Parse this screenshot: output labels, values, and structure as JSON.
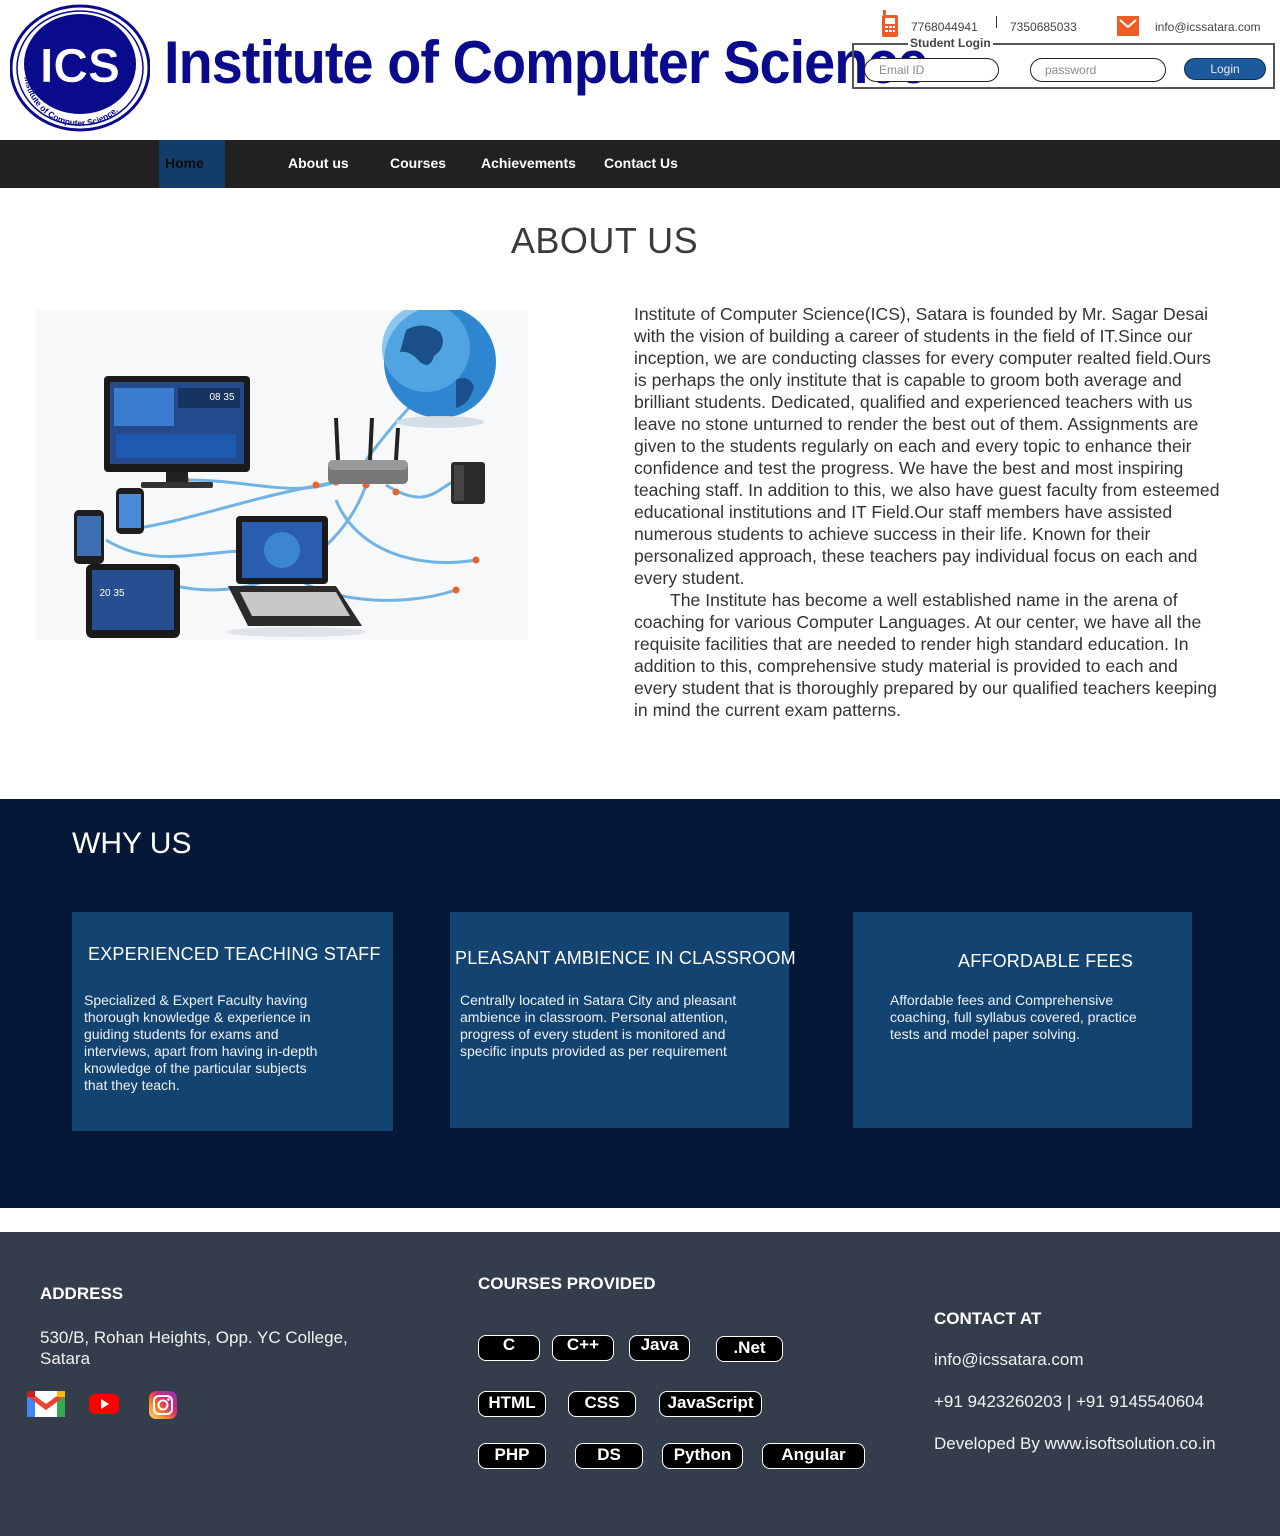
{
  "header": {
    "logo_text": "ICS",
    "logo_ring_text": "Institute of Computer Science.",
    "title": "Institute of Computer Science",
    "phone1": "7768044941",
    "phone2": "7350685033",
    "email": "info@icssatara.com",
    "login": {
      "legend": "Student Login",
      "email_placeholder": "Email ID",
      "password_placeholder": "password",
      "button": "Login"
    }
  },
  "nav": {
    "items": [
      {
        "label": "Home",
        "active": true
      },
      {
        "label": "About us"
      },
      {
        "label": "Courses"
      },
      {
        "label": "Achievements"
      },
      {
        "label": "Contact Us"
      }
    ]
  },
  "about": {
    "title": "ABOUT US",
    "paragraph1": "Institute of Computer Science(ICS), Satara is founded by Mr. Sagar Desai with the vision of building a career of students in the field of IT.Since our inception, we are conducting classes for every computer realted field.Ours is perhaps the only institute that is capable to groom both average and brilliant students. Dedicated, qualified and experienced teachers with us leave no stone unturned to render the best out of them. Assignments are given to the students regularly on each and every topic to enhance their confidence and test the progress. We have the best and most inspiring teaching staff. In addition to this, we also have guest faculty from esteemed educational institutions and IT Field.Our staff members have assisted numerous students to achieve success in their life. Known for their personalized approach, these teachers pay individual focus on each and every student.",
    "paragraph2": "The Institute has become a well established name in the arena of coaching for various Computer Languages. At our center, we have all the requisite facilities that are needed to render high standard education. In addition to this, comprehensive study material is provided to each and every student that is thoroughly prepared by our qualified teachers keeping in mind the current exam patterns.",
    "image_screen1": "08 35",
    "image_screen2": "20 35"
  },
  "why": {
    "title": "WHY US",
    "cards": [
      {
        "title": "EXPERIENCED TEACHING STAFF",
        "text": "Specialized & Expert Faculty having thorough knowledge & experience in guiding students for exams and interviews, apart from having in-depth knowledge of the particular subjects that they teach."
      },
      {
        "title": "PLEASANT AMBIENCE IN CLASSROOM",
        "text": "Centrally located in Satara City and pleasant ambience in classroom. Personal attention, progress of every student is monitored and specific inputs provided as per requirement"
      },
      {
        "title": "AFFORDABLE FEES",
        "text": "Affordable fees and Comprehensive coaching, full syllabus covered, practice tests and model paper solving."
      }
    ]
  },
  "footer": {
    "address_heading": "ADDRESS",
    "address": "530/B, Rohan Heights, Opp. YC College, Satara",
    "courses_heading": "COURSES PROVIDED",
    "courses": [
      "C",
      "C++",
      "Java",
      ".Net",
      "HTML",
      "CSS",
      "JavaScript",
      "PHP",
      "DS",
      "Python",
      "Angular"
    ],
    "contact_heading": "CONTACT AT",
    "email": "info@icssatara.com",
    "phones": "+91 9423260203 | +91 9145540604",
    "developed_by": "Developed By www.isoftsolution.co.in"
  },
  "icons": [
    "phone-icon",
    "mail-icon",
    "gmail-icon",
    "youtube-icon",
    "instagram-icon"
  ],
  "colors": {
    "brand_blue": "#0a0a8c",
    "nav_bg": "#212121",
    "nav_active": "#123d6b",
    "why_bg": "#051838",
    "card_bg": "#134370",
    "footer_bg": "#333d4b",
    "login_button": "#1c5a9c",
    "accent_orange": "#f05a24"
  }
}
